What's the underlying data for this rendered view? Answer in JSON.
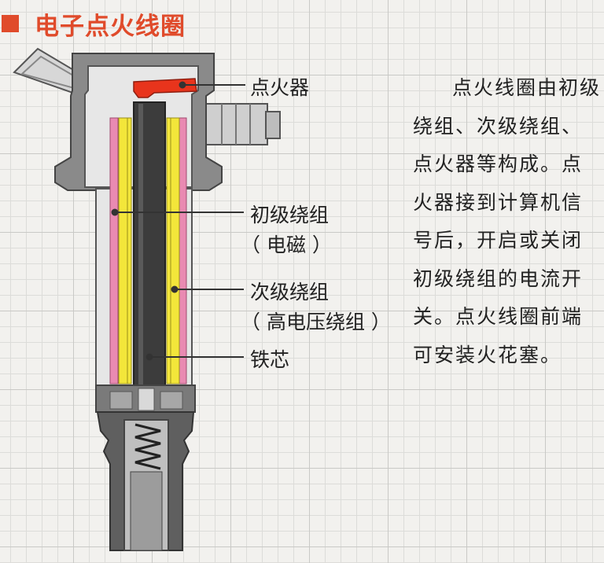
{
  "title": "电子点火线圈",
  "labels": {
    "igniter": "点火器",
    "primary": "初级绕组",
    "primary_sub": "（ 电磁 ）",
    "secondary": "次级绕组",
    "secondary_sub": "（ 高电压绕组 ）",
    "core": "铁芯"
  },
  "description": "点火线圈由初级绕组、次级绕组、点火器等构成。点火器接到计算机信号后，开启或关闭初级绕组的电流开关。点火线圈前端可安装火花塞。",
  "colors": {
    "title": "#e04b2b",
    "igniter": "#e8341c",
    "primary_winding": "#e98ab2",
    "secondary_winding": "#f3e63a",
    "core": "#3c3c3c",
    "housing": "#6b6b6b"
  }
}
